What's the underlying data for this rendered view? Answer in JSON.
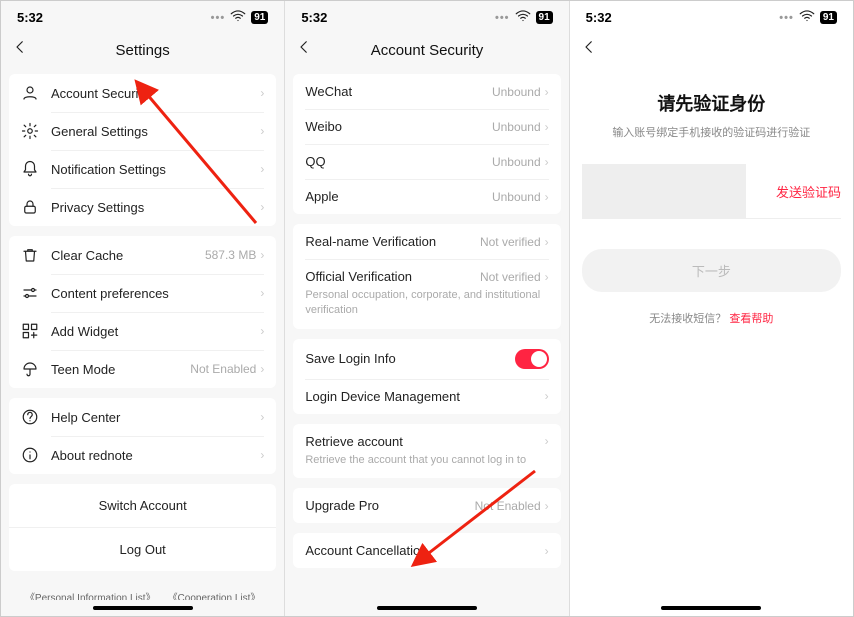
{
  "status": {
    "time": "5:32",
    "battery": "91"
  },
  "screen1": {
    "title": "Settings",
    "g1": [
      {
        "label": "Account Security"
      },
      {
        "label": "General Settings"
      },
      {
        "label": "Notification Settings"
      },
      {
        "label": "Privacy Settings"
      }
    ],
    "g2": [
      {
        "label": "Clear Cache",
        "value": "587.3 MB"
      },
      {
        "label": "Content preferences"
      },
      {
        "label": "Add Widget"
      },
      {
        "label": "Teen Mode",
        "value": "Not Enabled"
      }
    ],
    "g3": [
      {
        "label": "Help Center"
      },
      {
        "label": "About rednote"
      }
    ],
    "switch": "Switch Account",
    "logout": "Log Out",
    "footer1": "《Personal Information List》",
    "footer2": "《Cooperation List》"
  },
  "screen2": {
    "title": "Account Security",
    "bindings": [
      {
        "label": "WeChat",
        "value": "Unbound"
      },
      {
        "label": "Weibo",
        "value": "Unbound"
      },
      {
        "label": "QQ",
        "value": "Unbound"
      },
      {
        "label": "Apple",
        "value": "Unbound"
      }
    ],
    "verify": [
      {
        "label": "Real-name Verification",
        "value": "Not verified"
      },
      {
        "label": "Official Verification",
        "value": "Not verified"
      }
    ],
    "verify_desc": "Personal occupation, corporate, and institutional verification",
    "login": [
      {
        "label": "Save Login Info"
      },
      {
        "label": "Login Device Management"
      }
    ],
    "retrieve": {
      "label": "Retrieve account",
      "desc": "Retrieve the account that you cannot log in to"
    },
    "upgrade": {
      "label": "Upgrade Pro",
      "value": "Not Enabled"
    },
    "cancel": {
      "label": "Account Cancellation"
    }
  },
  "screen3": {
    "title": "请先验证身份",
    "subtitle": "输入账号绑定手机接收的验证码进行验证",
    "send": "发送验证码",
    "next": "下一步",
    "help_text": "无法接收短信？",
    "help_link": "查看帮助"
  }
}
